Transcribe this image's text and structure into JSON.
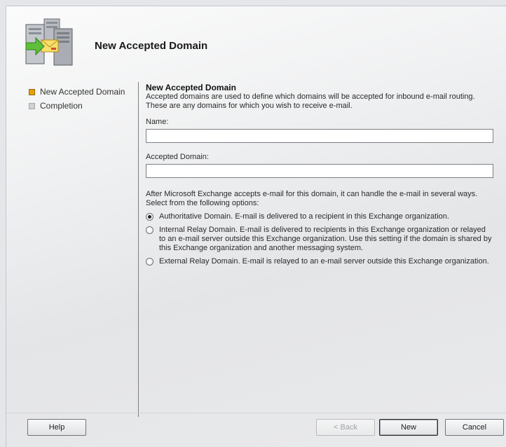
{
  "wizard": {
    "title": "New Accepted Domain",
    "icon": "server-mail-icon"
  },
  "steps": [
    {
      "label": "New Accepted Domain",
      "state": "active"
    },
    {
      "label": "Completion",
      "state": "inactive"
    }
  ],
  "content": {
    "title": "New Accepted Domain",
    "description": "Accepted domains are used to define which domains will be accepted for inbound e-mail routing.  These are any domains for which you wish to receive e-mail.",
    "name_label": "Name:",
    "name_value": "",
    "domain_label": "Accepted Domain:",
    "domain_value": "",
    "options_intro": "After Microsoft Exchange accepts e-mail for this domain, it can handle the e-mail in several ways. Select from the following options:",
    "options": [
      {
        "label": "Authoritative Domain. E-mail is delivered to a recipient in this Exchange organization.",
        "checked": true
      },
      {
        "label": "Internal Relay Domain. E-mail is delivered to recipients in this Exchange organization or relayed to an e-mail server outside this Exchange organization. Use this setting if the domain is shared by this Exchange organization and another messaging system.",
        "checked": false
      },
      {
        "label": "External Relay Domain. E-mail is relayed to an e-mail server outside this Exchange organization.",
        "checked": false
      }
    ]
  },
  "footer": {
    "help_label": "Help",
    "back_label": "< Back",
    "new_label": "New",
    "cancel_label": "Cancel"
  },
  "colors": {
    "active_step": "#e8a000",
    "inactive_step": "#cfd1d4"
  }
}
